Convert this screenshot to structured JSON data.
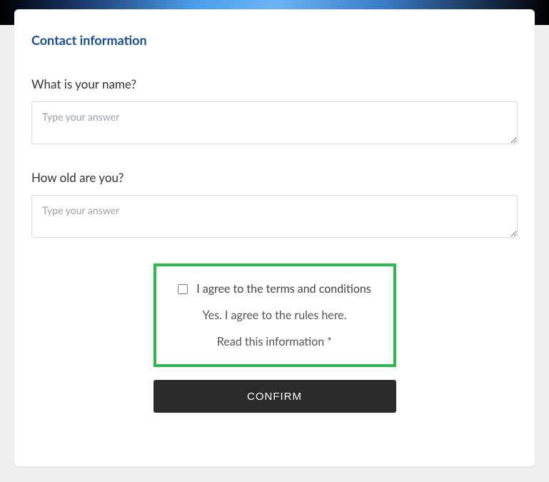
{
  "header": {
    "title": "Contact information"
  },
  "fields": {
    "name": {
      "label": "What is your name?",
      "placeholder": "Type your answer",
      "value": ""
    },
    "age": {
      "label": "How old are you?",
      "placeholder": "Type your answer",
      "value": ""
    }
  },
  "consent": {
    "checkbox_label": "I agree to the terms and conditions",
    "subtext": "Yes. I agree to the rules here.",
    "link_text": "Read this information *",
    "checked": false
  },
  "actions": {
    "confirm_label": "CONFIRM"
  },
  "colors": {
    "title": "#1a4d8f",
    "consent_border": "#2fb84f",
    "button_bg": "#2b2b2b"
  }
}
